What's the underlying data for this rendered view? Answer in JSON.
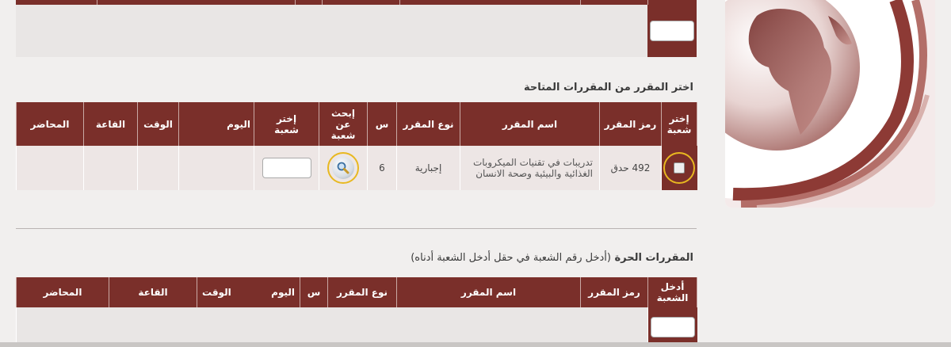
{
  "available": {
    "title": "اختر المقرر من المقررات المتاحة",
    "headers": {
      "select_section": "إختر شعبة",
      "course_code": "رمز المقرر",
      "course_name": "اسم المقرر",
      "course_type": "نوع المقرر",
      "hours": "س",
      "search_section": "إبحث عن شعبة",
      "choose_section": "إختر شعبة",
      "day": "اليوم",
      "time": "الوقت",
      "room": "القاعة",
      "lecturer": "المحاضر"
    },
    "row": {
      "course_code": "492 حدق",
      "course_name": "تدريبات في تقنيات الميكروبات الغذائية والبيئية وصحة الانسان",
      "course_type": "إجبارية",
      "hours": "6",
      "section_value": "",
      "day": "",
      "time": "",
      "room": "",
      "lecturer": ""
    }
  },
  "free": {
    "title": "المقررات الحرة",
    "note": "(أدخل رقم الشعبة في حقل أدخل الشعبة أدناه)",
    "headers": {
      "enter_section": "أدخل الشعبة",
      "course_code": "رمز المقرر",
      "course_name": "اسم المقرر",
      "course_type": "نوع المقرر",
      "hours": "س",
      "day": "اليوم",
      "time": "الوقت",
      "room": "القاعة",
      "lecturer": "المحاضر"
    }
  },
  "colors": {
    "header_bg": "#7a2f2a",
    "row_bg": "#ede6e5",
    "highlight": "#e8b820",
    "page_bg": "#f1efee"
  },
  "icons": {
    "search": "magnifier-icon",
    "logo": "globe-logo"
  }
}
